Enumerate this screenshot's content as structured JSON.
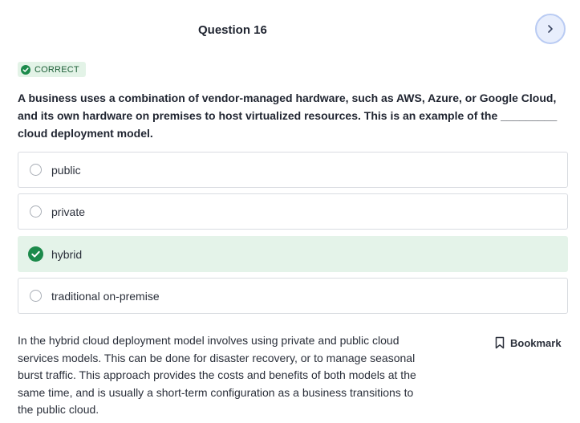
{
  "header": {
    "title": "Question 16",
    "next_icon": "chevron-right-icon"
  },
  "result": {
    "label": "CORRECT",
    "icon": "check-circle-icon",
    "color": "#1c8a4b"
  },
  "question": {
    "text": "A business uses a combination of vendor-managed hardware, such as AWS, Azure, or Google Cloud, and its own hardware on premises to host virtualized resources. This is an example of the _________ cloud deployment model."
  },
  "options": [
    {
      "label": "public",
      "state": "unselected"
    },
    {
      "label": "private",
      "state": "unselected"
    },
    {
      "label": "hybrid",
      "state": "correct"
    },
    {
      "label": "traditional on-premise",
      "state": "unselected"
    }
  ],
  "explanation": {
    "text": "In the hybrid cloud deployment model involves using private and public cloud services models. This can be done for disaster recovery, or to manage seasonal burst traffic. This approach provides the costs and benefits of both models at the same time, and is usually a short-term configuration as a business transitions to the public cloud."
  },
  "bookmark": {
    "label": "Bookmark",
    "icon": "bookmark-icon"
  },
  "colors": {
    "correct_bg": "#e4f3e9",
    "correct_accent": "#1c8a4b",
    "next_button_bg": "#e8eefc"
  }
}
